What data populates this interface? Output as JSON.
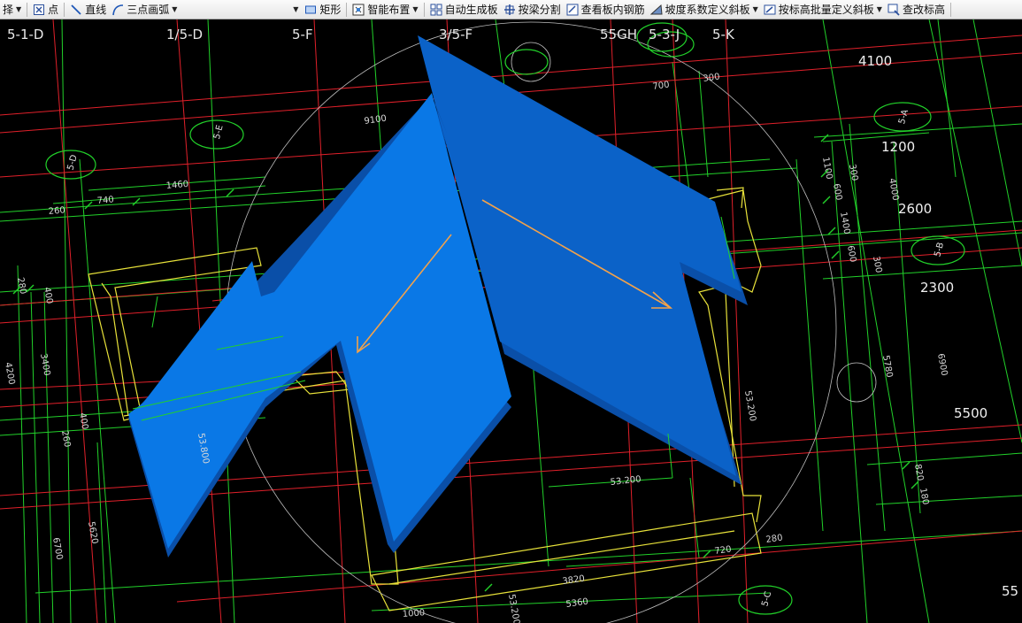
{
  "toolbar": {
    "items": [
      {
        "label": "择",
        "icon": "select-icon",
        "has_caret": true
      },
      {
        "label": "点",
        "icon": "point-icon",
        "has_caret": false
      },
      {
        "label": "直线",
        "icon": "line-icon",
        "has_caret": false
      },
      {
        "label": "三点画弧",
        "icon": "arc-icon",
        "has_caret": true
      },
      {
        "label": "",
        "icon": "",
        "has_caret": true
      },
      {
        "label": "矩形",
        "icon": "rectangle-icon",
        "has_caret": false
      },
      {
        "label": "智能布置",
        "icon": "smart-layout-icon",
        "has_caret": true
      },
      {
        "label": "自动生成板",
        "icon": "auto-slab-icon",
        "has_caret": false
      },
      {
        "label": "按梁分割",
        "icon": "split-by-beam-icon",
        "has_caret": false
      },
      {
        "label": "查看板内钢筋",
        "icon": "view-rebar-icon",
        "has_caret": false
      },
      {
        "label": "坡度系数定义斜板",
        "icon": "slope-coefficient-icon",
        "has_caret": true
      },
      {
        "label": "按标高批量定义斜板",
        "icon": "batch-elevation-icon",
        "has_caret": true
      },
      {
        "label": "查改标高",
        "icon": "edit-elevation-icon",
        "has_caret": false
      }
    ]
  },
  "canvas": {
    "axis_labels_top": [
      "5-1-D",
      "1/5-D",
      "5-F",
      "3/5-F",
      "55GH",
      "5-3-J",
      "5-K"
    ],
    "axis_bubbles": [
      "5-E",
      "5-D",
      "5-A",
      "5-B",
      "5-C"
    ],
    "right_dimensions": [
      "4100",
      "1200",
      "2600",
      "2300",
      "5500",
      "55"
    ],
    "small_dimensions": [
      "9100",
      "700",
      "300",
      "740",
      "1460",
      "260",
      "1100",
      "300",
      "600",
      "1400",
      "600",
      "300",
      "4000",
      "280",
      "400",
      "4200",
      "3400",
      "400",
      "260",
      "5620",
      "6700",
      "5780",
      "6900",
      "820",
      "180",
      "720",
      "280",
      "3820",
      "5360",
      "1000",
      "53.200",
      "53.800",
      "53.200",
      "53.200"
    ],
    "colors": {
      "background": "#000000",
      "grid_red": "#e0202a",
      "grid_green": "#22d12a",
      "wall_yellow": "#e8e23a",
      "slab_blue": "#0a78e6",
      "slab_blue_dark": "#0b5fc4",
      "slab_edge": "#0a4fa8",
      "arrow_orange": "#f3a24a"
    }
  }
}
